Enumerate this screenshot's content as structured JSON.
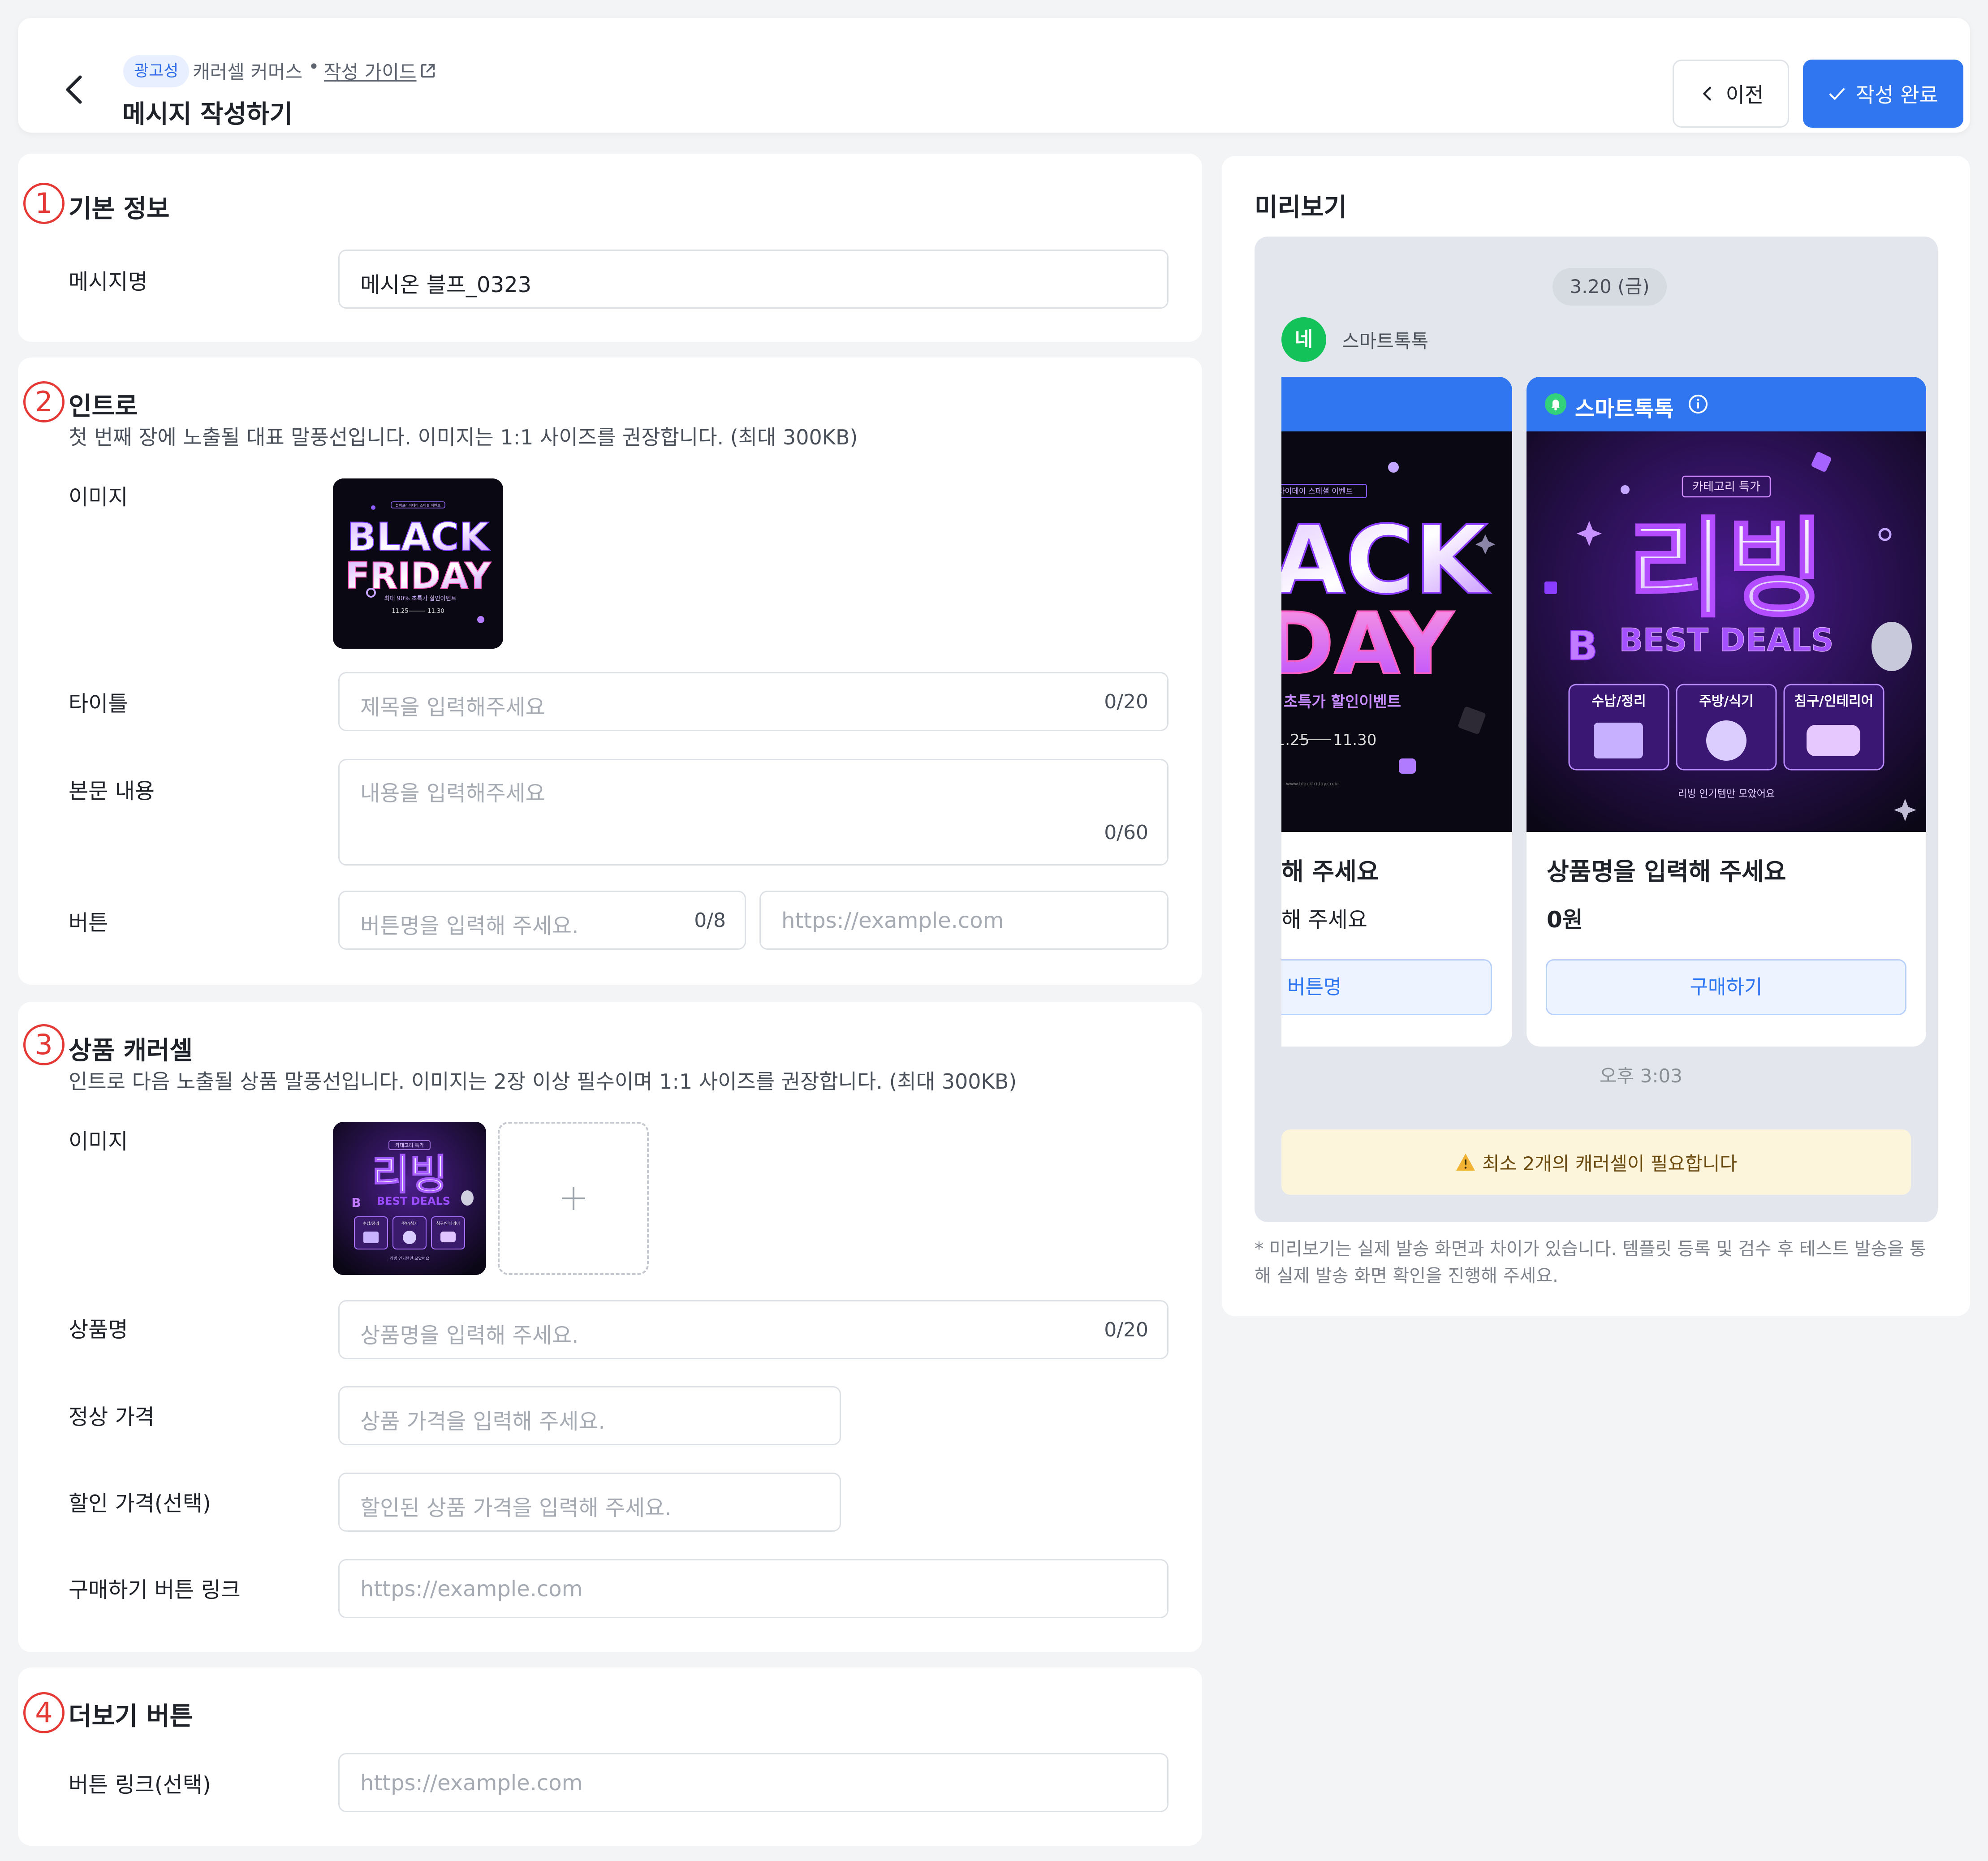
{
  "header": {
    "tag": "광고성",
    "brand": "캐러셀 커머스",
    "separator": "•",
    "guide_link": "작성 가이드",
    "title": "메시지 작성하기",
    "prev_label": "이전",
    "done_label": "작성 완료"
  },
  "sections": {
    "basic": {
      "number": "1",
      "title": "기본 정보",
      "message_name_label": "메시지명",
      "message_name_value": "메시온 블프_0323"
    },
    "intro": {
      "number": "2",
      "title": "인트로",
      "desc": "첫 번째 장에 노출될 대표 말풍선입니다.  이미지는 1:1 사이즈를 권장합니다. (최대 300KB)",
      "image_label": "이미지",
      "title_label": "타이틀",
      "title_placeholder": "제목을 입력해주세요",
      "title_count": "0/20",
      "body_label": "본문 내용",
      "body_placeholder": "내용을 입력해주세요",
      "body_count": "0/60",
      "button_label": "버튼",
      "button_name_placeholder": "버튼명을 입력해 주세요.",
      "button_name_count": "0/8",
      "button_url_placeholder": "https://example.com"
    },
    "carousel": {
      "number": "3",
      "title": "상품 캐러셀",
      "desc": "인트로 다음 노출될 상품 말풍선입니다. 이미지는 2장 이상 필수이며 1:1 사이즈를 권장합니다. (최대 300KB)",
      "image_label": "이미지",
      "product_name_label": "상품명",
      "product_name_placeholder": "상품명을 입력해 주세요.",
      "product_name_count": "0/20",
      "regular_price_label": "정상 가격",
      "regular_price_placeholder": "상품 가격을 입력해 주세요.",
      "sale_price_label": "할인 가격(선택)",
      "sale_price_placeholder": "할인된 상품 가격을 입력해 주세요.",
      "buy_link_label": "구매하기 버튼 링크",
      "buy_link_placeholder": "https://example.com"
    },
    "more": {
      "number": "4",
      "title": "더보기 버튼",
      "link_label": "버튼 링크(선택)",
      "link_placeholder": "https://example.com"
    }
  },
  "images": {
    "black_friday": {
      "word1": "BLACK",
      "word2": "FRIDAY",
      "word1_partial": "ACK",
      "word2_partial": "DAY",
      "badge": "블랙프라이데이 스페셜 이벤트",
      "tagline": "최대 90% 초특가 할인이벤트",
      "tagline_partial": "초특가 할인이벤트",
      "date_start": "11.25",
      "date_end": "11.30",
      "date_end_partial": "11.30",
      "site": "www.blackfriday.co.kr"
    },
    "living": {
      "badge": "카테고리 특가",
      "title": "리빙",
      "best_deals": "BEST DEALS",
      "letter": "B",
      "cat1": "수납/정리",
      "cat2": "주방/식기",
      "cat3": "침구/인테리어",
      "footer": "리빙 인기템만 모았어요"
    }
  },
  "preview": {
    "title": "미리보기",
    "date": "3.20 (금)",
    "avatar_letter": "네",
    "sender": "스마트톡톡",
    "card_header": "스마트톡톡",
    "intro_title_partial": "해 주세요",
    "intro_body_partial": "해 주세요",
    "intro_button": "버튼명",
    "product_name": "상품명을 입력해 주세요",
    "product_price": "0원",
    "buy_button": "구매하기",
    "time": "오후 3:03",
    "warning": "최소 2개의 캐러셀이 필요합니다",
    "note": "* 미리보기는 실제 발송 화면과 차이가 있습니다. 템플릿 등록 및 검수 후 테스트 발송을 통해 실제 발송 화면 확인을 진행해 주세요."
  },
  "colors": {
    "primary": "#2f76f0",
    "annotation": "#e53935",
    "avatar": "#13c35a",
    "warning_bg": "#fdf5db",
    "neon_purple": "#b35cff",
    "neon_pink": "#ff5ec4"
  },
  "icons": [
    "chevron-left-icon",
    "external-link-icon",
    "check-icon",
    "plus-icon",
    "bell-icon",
    "info-icon",
    "warning-icon"
  ]
}
